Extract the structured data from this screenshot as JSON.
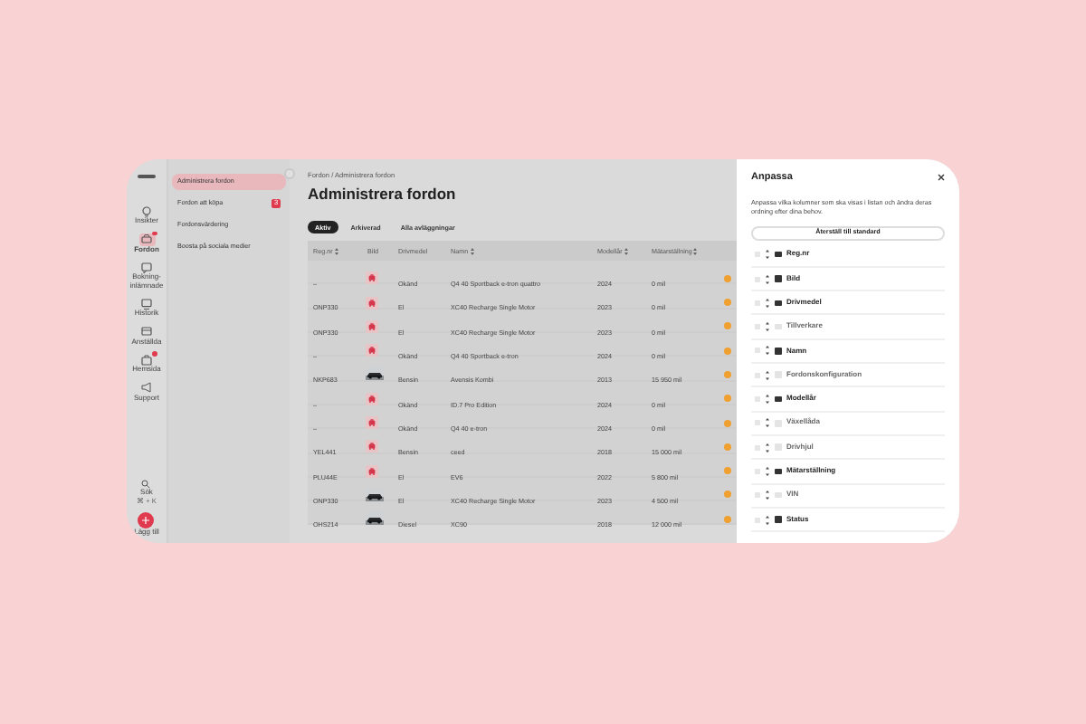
{
  "rail": {
    "items": [
      {
        "label": "Insikter",
        "kind": "bulb",
        "selected": false,
        "badge": false
      },
      {
        "label": "Fordon",
        "kind": "car",
        "selected": true,
        "badge": true
      },
      {
        "label": "Bokning-inlämnade",
        "kind": "chat",
        "selected": false,
        "badge": false
      },
      {
        "label": "Historik",
        "kind": "screen",
        "selected": false,
        "badge": false
      },
      {
        "label": "Anställda",
        "kind": "card",
        "selected": false,
        "badge": false
      },
      {
        "label": "Hemsida",
        "kind": "box",
        "selected": false,
        "badge": true
      },
      {
        "label": "Support",
        "kind": "megaphone",
        "selected": false,
        "badge": false
      }
    ],
    "search": {
      "label": "Sök",
      "shortcut": "⌘ + K"
    },
    "add": {
      "label": "Lägg till"
    }
  },
  "submenu": {
    "items": [
      {
        "label": "Administrera fordon",
        "selected": true
      },
      {
        "label": "Fordon att köpa",
        "selected": false,
        "badge": "3"
      },
      {
        "label": "Fordonsvärdering",
        "selected": false
      },
      {
        "label": "Boosta på sociala medier",
        "selected": false
      }
    ]
  },
  "breadcrumb": "Fordon / Administrera fordon",
  "title": "Administrera fordon",
  "tabs": [
    {
      "label": "Aktiv",
      "selected": true
    },
    {
      "label": "Arkiverad",
      "selected": false
    },
    {
      "label": "Alla avläggningar",
      "selected": false
    }
  ],
  "table": {
    "columns": [
      {
        "label": "Reg.nr",
        "sortable": true
      },
      {
        "label": "Bild",
        "sortable": false
      },
      {
        "label": "Drivmedel",
        "sortable": false
      },
      {
        "label": "Namn",
        "sortable": true
      },
      {
        "label": "Modellår",
        "sortable": true
      },
      {
        "label": "Mätarställning",
        "sortable": true
      }
    ],
    "rows": [
      {
        "reg": "–",
        "kind": "placeholder",
        "fuel": "Okänd",
        "name": "Q4 40 Sportback e-tron quattro",
        "year": "2024",
        "mileage": "0 mil"
      },
      {
        "reg": "ONP330",
        "kind": "placeholder",
        "fuel": "El",
        "name": "XC40 Recharge Single Motor",
        "year": "2023",
        "mileage": "0 mil"
      },
      {
        "reg": "ONP330",
        "kind": "placeholder",
        "fuel": "El",
        "name": "XC40 Recharge Single Motor",
        "year": "2023",
        "mileage": "0 mil"
      },
      {
        "reg": "–",
        "kind": "placeholder",
        "fuel": "Okänd",
        "name": "Q4 40 Sportback e-tron",
        "year": "2024",
        "mileage": "0 mil"
      },
      {
        "reg": "NKP683",
        "fuel": "Bensin",
        "name": "Avensis Kombi",
        "year": "2013",
        "mileage": "15 950 mil"
      },
      {
        "reg": "–",
        "kind": "placeholder",
        "fuel": "Okänd",
        "name": "ID.7 Pro Edition",
        "year": "2024",
        "mileage": "0 mil"
      },
      {
        "reg": "–",
        "kind": "placeholder",
        "fuel": "Okänd",
        "name": "Q4 40 e-tron",
        "year": "2024",
        "mileage": "0 mil"
      },
      {
        "reg": "YEL441",
        "kind": "placeholder",
        "fuel": "Bensin",
        "name": "ceed",
        "year": "2018",
        "mileage": "15 000 mil"
      },
      {
        "reg": "PLU44E",
        "kind": "placeholder",
        "fuel": "El",
        "name": "EV6",
        "year": "2022",
        "mileage": "5 800 mil"
      },
      {
        "reg": "ONP330",
        "fuel": "El",
        "name": "XC40 Recharge Single Motor",
        "year": "2023",
        "mileage": "4 500 mil"
      },
      {
        "reg": "OHS214",
        "fuel": "Diesel",
        "name": "XC90",
        "year": "2018",
        "mileage": "12 000 mil"
      }
    ]
  },
  "drawer": {
    "title": "Anpassa",
    "description": "Anpassa vilka kolumner som ska visas i listan och ändra deras ordning efter dina behov.",
    "reset_button": "Återställ till standard",
    "columns": [
      {
        "label": "Reg.nr",
        "checked": true
      },
      {
        "label": "Bild",
        "checked": true
      },
      {
        "label": "Drivmedel",
        "checked": true
      },
      {
        "label": "Tillverkare",
        "checked": false
      },
      {
        "label": "Namn",
        "checked": true
      },
      {
        "label": "Fordonskonfiguration",
        "checked": false
      },
      {
        "label": "Modellår",
        "checked": true
      },
      {
        "label": "Växellåda",
        "checked": false
      },
      {
        "label": "Drivhjul",
        "checked": false
      },
      {
        "label": "Mätarställning",
        "checked": true
      },
      {
        "label": "VIN",
        "checked": false
      },
      {
        "label": "Status",
        "checked": true
      }
    ]
  }
}
